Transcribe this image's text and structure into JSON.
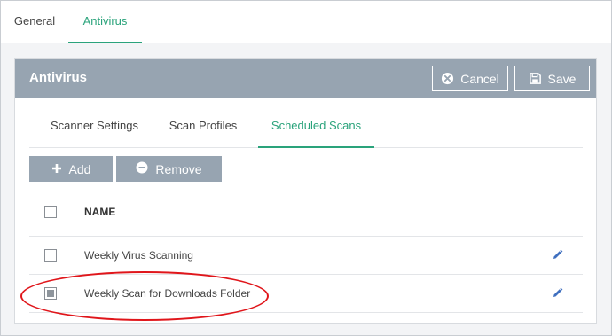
{
  "top_tabs": [
    {
      "label": "General",
      "active": false
    },
    {
      "label": "Antivirus",
      "active": true
    }
  ],
  "panel": {
    "title": "Antivirus",
    "cancel_label": "Cancel",
    "save_label": "Save"
  },
  "sub_tabs": [
    {
      "label": "Scanner Settings",
      "active": false
    },
    {
      "label": "Scan Profiles",
      "active": false
    },
    {
      "label": "Scheduled Scans",
      "active": true
    }
  ],
  "actions": {
    "add_label": "Add",
    "remove_label": "Remove"
  },
  "table": {
    "header": "NAME",
    "rows": [
      {
        "name": "Weekly Virus Scanning",
        "checked": false
      },
      {
        "name": "Weekly Scan for Downloads Folder",
        "checked": true
      }
    ]
  },
  "colors": {
    "accent": "#2aa37b",
    "header_bar": "#97a4b1",
    "edit_icon": "#3f6fbf",
    "highlight": "#e0161b"
  },
  "icons": [
    "cancel-icon",
    "save-icon",
    "plus-icon",
    "minus-icon",
    "edit-pencil-icon"
  ]
}
